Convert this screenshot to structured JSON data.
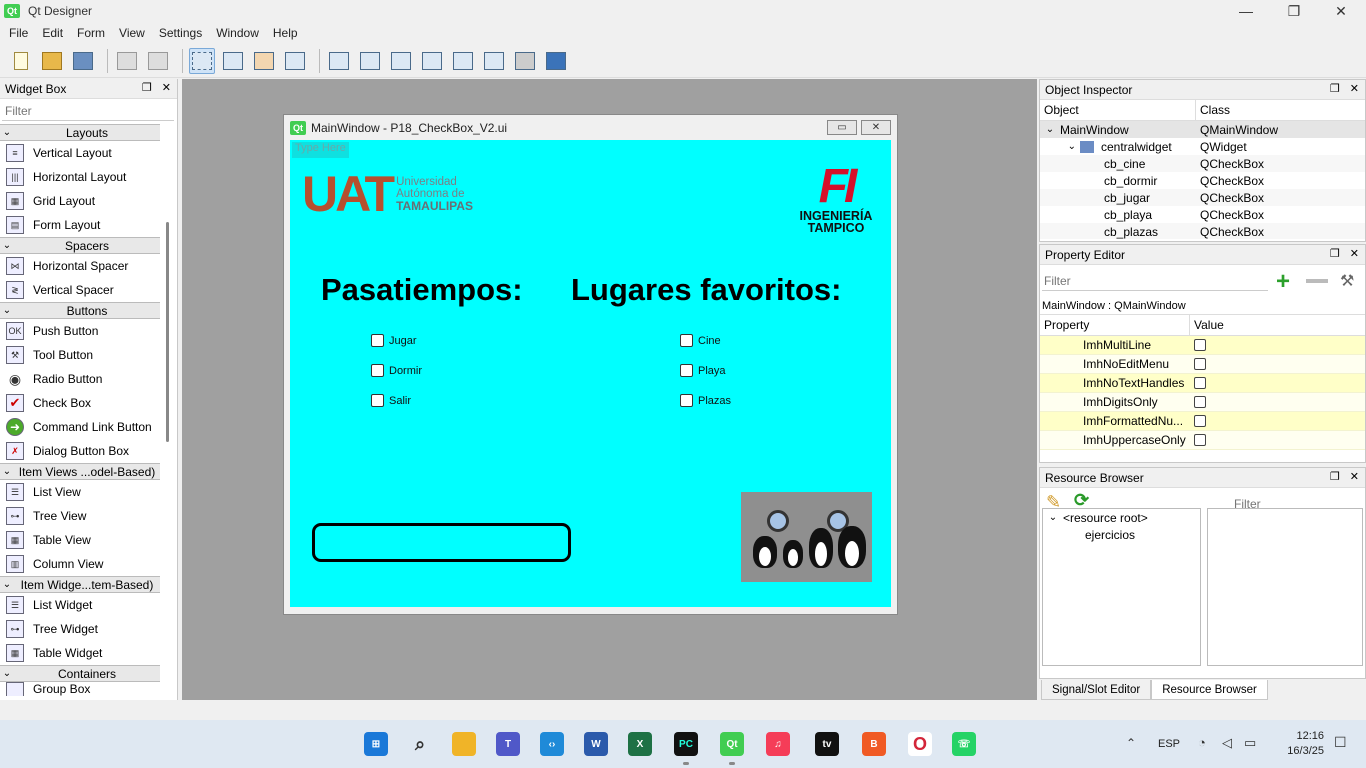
{
  "app": {
    "title": "Qt Designer",
    "icon_text": "Qt",
    "minimize_glyph": "—",
    "restore_glyph": "❐",
    "close_glyph": "✕"
  },
  "menubar": [
    "File",
    "Edit",
    "Form",
    "View",
    "Settings",
    "Window",
    "Help"
  ],
  "widget_box": {
    "title": "Widget Box",
    "filter_placeholder": "Filter",
    "categories": [
      {
        "label": "Layouts",
        "items": [
          "Vertical Layout",
          "Horizontal Layout",
          "Grid Layout",
          "Form Layout"
        ]
      },
      {
        "label": "Spacers",
        "items": [
          "Horizontal Spacer",
          "Vertical Spacer"
        ]
      },
      {
        "label": "Buttons",
        "items": [
          "Push Button",
          "Tool Button",
          "Radio Button",
          "Check Box",
          "Command Link Button",
          "Dialog Button Box"
        ]
      },
      {
        "label": "Item Views ...odel-Based)",
        "items": [
          "List View",
          "Tree View",
          "Table View",
          "Column View"
        ]
      },
      {
        "label": "Item Widge...tem-Based)",
        "items": [
          "List Widget",
          "Tree Widget",
          "Table Widget"
        ]
      },
      {
        "label": "Containers",
        "items": [
          "Group Box"
        ]
      }
    ]
  },
  "form": {
    "window_title": "MainWindow - P18_CheckBox_V2.ui",
    "icon_text": "Qt",
    "type_here": "Type Here",
    "uat_logo": {
      "letters": "UAT",
      "line1": "Universidad",
      "line2": "Autónoma de",
      "line3": "TAMAULIPAS"
    },
    "fi_logo": {
      "mark": "FI",
      "line1": "INGENIERÍA",
      "line2": "TAMPICO"
    },
    "heading_left": "Pasatiempos:",
    "heading_right": "Lugares favoritos:",
    "checkboxes_left": [
      "Jugar",
      "Dormir",
      "Salir"
    ],
    "checkboxes_right": [
      "Cine",
      "Playa",
      "Plazas"
    ],
    "background_color": "#00ffff"
  },
  "object_inspector": {
    "title": "Object Inspector",
    "columns": [
      "Object",
      "Class"
    ],
    "rows": [
      {
        "object": "MainWindow",
        "class": "QMainWindow"
      },
      {
        "object": "centralwidget",
        "class": "QWidget"
      },
      {
        "object": "cb_cine",
        "class": "QCheckBox"
      },
      {
        "object": "cb_dormir",
        "class": "QCheckBox"
      },
      {
        "object": "cb_jugar",
        "class": "QCheckBox"
      },
      {
        "object": "cb_playa",
        "class": "QCheckBox"
      },
      {
        "object": "cb_plazas",
        "class": "QCheckBox"
      }
    ]
  },
  "property_editor": {
    "title": "Property Editor",
    "filter_placeholder": "Filter",
    "context": "MainWindow : QMainWindow",
    "columns": [
      "Property",
      "Value"
    ],
    "rows": [
      "ImhMultiLine",
      "ImhNoEditMenu",
      "ImhNoTextHandles",
      "ImhDigitsOnly",
      "ImhFormattedNu...",
      "ImhUppercaseOnly"
    ]
  },
  "resource_browser": {
    "title": "Resource Browser",
    "filter_placeholder": "Filter",
    "tree": [
      "<resource root>",
      "ejercicios"
    ]
  },
  "bottom_tabs": [
    "Signal/Slot Editor",
    "Resource Browser"
  ],
  "taskbar": {
    "apps": [
      "windows-start",
      "search",
      "file-explorer",
      "teams",
      "vscode",
      "word",
      "excel",
      "pycharm",
      "qt-designer",
      "music",
      "apple-tv",
      "brave",
      "opera",
      "whatsapp"
    ],
    "language": "ESP",
    "time": "12:16",
    "date": "16/3/25"
  }
}
